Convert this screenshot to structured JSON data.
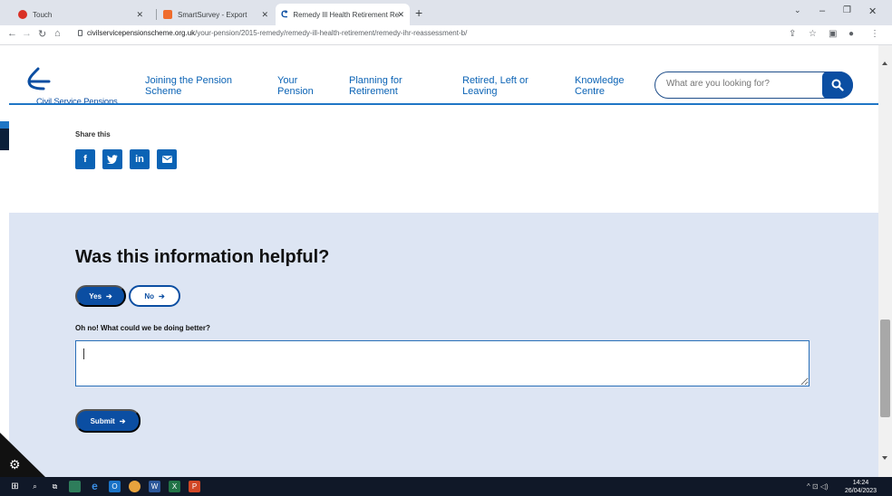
{
  "browser": {
    "tabs": [
      {
        "title": "Touch",
        "color": "#d93025"
      },
      {
        "title": "SmartSurvey - Export",
        "color": "#ef6c2c"
      },
      {
        "title": "Remedy Ill Health Retirement Re",
        "color": "#0b4ea2",
        "active": true
      }
    ],
    "url_domain": "civilservicepensionscheme.org.uk",
    "url_path": "/your-pension/2015-remedy/remedy-ill-health-retirement/remedy-ihr-reassessment-b/"
  },
  "site": {
    "logo_text": "Civil Service Pensions",
    "nav": [
      {
        "line1": "Joining the Pension",
        "line2": "Scheme"
      },
      {
        "line1": "Your",
        "line2": "Pension"
      },
      {
        "line1": "Planning for",
        "line2": "Retirement"
      },
      {
        "line1": "Retired, Left or",
        "line2": "Leaving"
      },
      {
        "line1": "Knowledge",
        "line2": "Centre"
      }
    ],
    "search_placeholder": "What are you looking for?"
  },
  "share": {
    "label": "Share this",
    "buttons": [
      "facebook-icon",
      "twitter-icon",
      "linkedin-icon",
      "email-icon"
    ]
  },
  "feedback": {
    "title": "Was this information helpful?",
    "yes_label": "Yes",
    "no_label": "No",
    "question": "Oh no! What could we be doing better?",
    "answer": "",
    "submit_label": "Submit"
  },
  "taskbar": {
    "time": "14:24",
    "date": "26/04/2023"
  },
  "colors": {
    "brand_blue": "#0b4ea2",
    "feedback_bg": "#dde5f3"
  }
}
